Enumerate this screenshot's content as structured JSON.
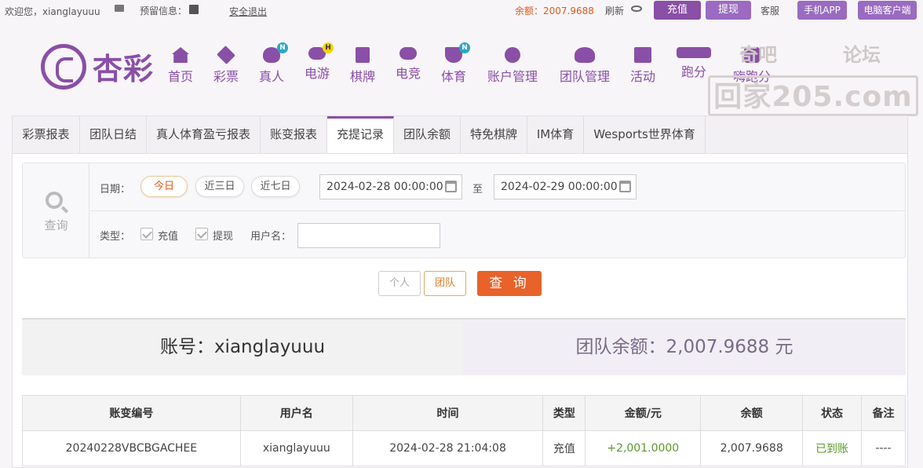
{
  "topbar": {
    "welcome": "欢迎您，xianglayuuu",
    "reserved": "预留信息：",
    "logout": "安全退出",
    "balance": "余额：2007.9688",
    "refresh": "刷新",
    "recharge": "充值",
    "withdraw": "提现",
    "service": "客服",
    "mobile_app": "手机APP",
    "pc_client": "电脑客户端"
  },
  "logo": {
    "text": "杏彩"
  },
  "nav": [
    {
      "label": "首页",
      "icon": "home-icon"
    },
    {
      "label": "彩票",
      "icon": "lottery-ticket-icon"
    },
    {
      "label": "真人",
      "icon": "live-dealer-icon",
      "badge": "N"
    },
    {
      "label": "电游",
      "icon": "gamepad-icon",
      "badge": "H"
    },
    {
      "label": "棋牌",
      "icon": "cards-icon"
    },
    {
      "label": "电竞",
      "icon": "esports-gamepad-icon"
    },
    {
      "label": "体育",
      "icon": "trophy-icon",
      "badge": "N"
    },
    {
      "label": "账户管理",
      "icon": "yen-account-icon"
    },
    {
      "label": "团队管理",
      "icon": "team-icon"
    },
    {
      "label": "活动",
      "icon": "gift-icon"
    },
    {
      "label": "跑分",
      "icon": "racing-icon"
    },
    {
      "label": "嗨跑分",
      "icon": "hi-run-icon"
    }
  ],
  "watermark": {
    "line1_left": "奇吧",
    "line1_right": "论坛",
    "line2": "回家205.com"
  },
  "tabs": [
    "彩票报表",
    "团队日结",
    "真人体育盈亏报表",
    "账变报表",
    "充提记录",
    "团队余额",
    "特免棋牌",
    "IM体育",
    "Wesports世界体育"
  ],
  "active_tab": "充提记录",
  "filter": {
    "query_label": "查询",
    "date_label": "日期：",
    "quick_ranges": [
      "今日",
      "近三日",
      "近七日"
    ],
    "selected_range": "今日",
    "start": "2024-02-28 00:00:00",
    "to": "至",
    "end": "2024-02-29 00:00:00",
    "type_label": "类型：",
    "types": [
      "充值",
      "提现"
    ],
    "username_label": "用户名：",
    "username_value": ""
  },
  "actions": {
    "personal": "个人",
    "team": "团队",
    "query": "查 询"
  },
  "summary": {
    "account": "账号：xianglayuuu",
    "team_balance": "团队余额：2,007.9688 元"
  },
  "table": {
    "headers": [
      "账变编号",
      "用户名",
      "时间",
      "类型",
      "金额/元",
      "余额",
      "状态",
      "备注"
    ],
    "rows": [
      [
        "20240228VBCBGACHEE",
        "xianglayuuu",
        "2024-02-28 21:04:08",
        "充值",
        "+2,001.0000",
        "2,007.9688",
        "已到账",
        "----"
      ]
    ]
  },
  "colors": {
    "brand": "#8a4fa6",
    "accent": "#e8622a",
    "success": "#5a9a2a"
  }
}
